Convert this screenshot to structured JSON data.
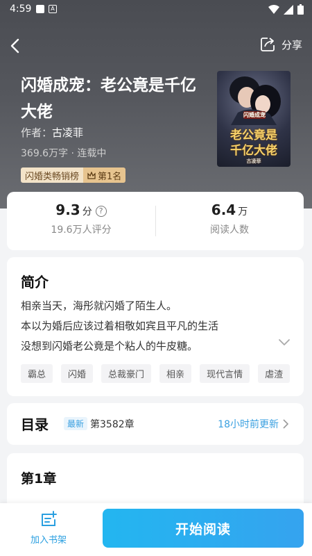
{
  "status": {
    "time": "4:59"
  },
  "nav": {
    "share_label": "分享"
  },
  "book": {
    "title": "闪婚成宠：老公竟是千亿大佬",
    "author_prefix": "作者：",
    "author": "古凌菲",
    "meta": "369.6万字 · 连载中",
    "rank_category": "闪婚类畅销榜",
    "rank_position": "第1名",
    "cover_tag": "闪婚成宠",
    "cover_line1": "老公竟是",
    "cover_line2": "千亿大佬",
    "cover_author": "古凌菲"
  },
  "stats": {
    "score": "9.3",
    "score_unit": "分",
    "score_sub": "19.6万人评分",
    "readers": "6.4",
    "readers_unit": "万",
    "readers_sub": "阅读人数"
  },
  "intro": {
    "title": "简介",
    "lines": [
      "相亲当天，海彤就闪婚了陌生人。",
      "本以为婚后应该过着相敬如宾且平凡的生活",
      "没想到闪婚老公竟是个粘人的牛皮糖。"
    ],
    "tags": [
      "霸总",
      "闪婚",
      "总裁豪门",
      "相亲",
      "现代言情",
      "虐渣"
    ]
  },
  "toc": {
    "title": "目录",
    "latest_badge": "最新",
    "latest_chapter": "第3582章",
    "updated": "18小时前更新"
  },
  "chapter_preview": {
    "title": "第1章"
  },
  "bottom": {
    "shelf_label": "加入书架",
    "read_label": "开始阅读"
  },
  "colors": {
    "accent": "#2fa9ee",
    "badge": "#e7c48f"
  },
  "icons": [
    "back-arrow-icon",
    "share-icon",
    "help-icon",
    "chevron-down-icon",
    "chevron-right-icon",
    "crown-icon",
    "bookshelf-add-icon"
  ]
}
